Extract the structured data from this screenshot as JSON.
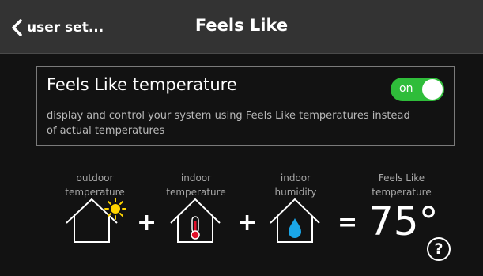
{
  "header": {
    "back_label": "user set...",
    "title": "Feels Like"
  },
  "card": {
    "title": "Feels Like temperature",
    "description": "display and control your system using Feels Like temperatures instead of actual temperatures",
    "toggle": {
      "label": "on",
      "state": true,
      "color": "#2fbd3a"
    }
  },
  "formula": {
    "outdoor": {
      "caption_line1": "outdoor",
      "caption_line2": "temperature",
      "icon": "house-sun-icon"
    },
    "plus1": "+",
    "indoor_temp": {
      "caption_line1": "indoor",
      "caption_line2": "temperature",
      "icon": "house-thermometer-icon"
    },
    "plus2": "+",
    "indoor_humidity": {
      "caption_line1": "indoor",
      "caption_line2": "humidity",
      "icon": "house-water-drop-icon"
    },
    "equals": "=",
    "feels_like": {
      "caption_line1": "Feels Like",
      "caption_line2": "temperature",
      "value": "75°"
    }
  },
  "help": {
    "label": "?"
  },
  "colors": {
    "header_bg": "#333333",
    "main_bg": "#121212",
    "sun": "#ffd400",
    "thermometer": "#e0102a",
    "drop": "#1aa6e8"
  }
}
